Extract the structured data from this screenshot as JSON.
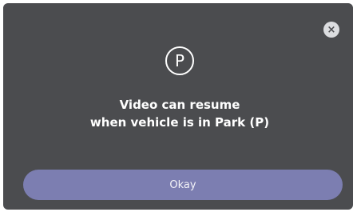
{
  "dialog": {
    "close_glyph": "×",
    "icon_letter": "P",
    "message_line1": "Video can resume",
    "message_line2": "when vehicle is in Park (P)",
    "button_label": "Okay"
  },
  "colors": {
    "dialog_bg": "#4b4c4f",
    "close_bg": "#dcdde0",
    "button_bg": "#7c7eb1",
    "text": "#ffffff"
  },
  "icons": {
    "close": "close-icon",
    "park": "park-icon"
  }
}
